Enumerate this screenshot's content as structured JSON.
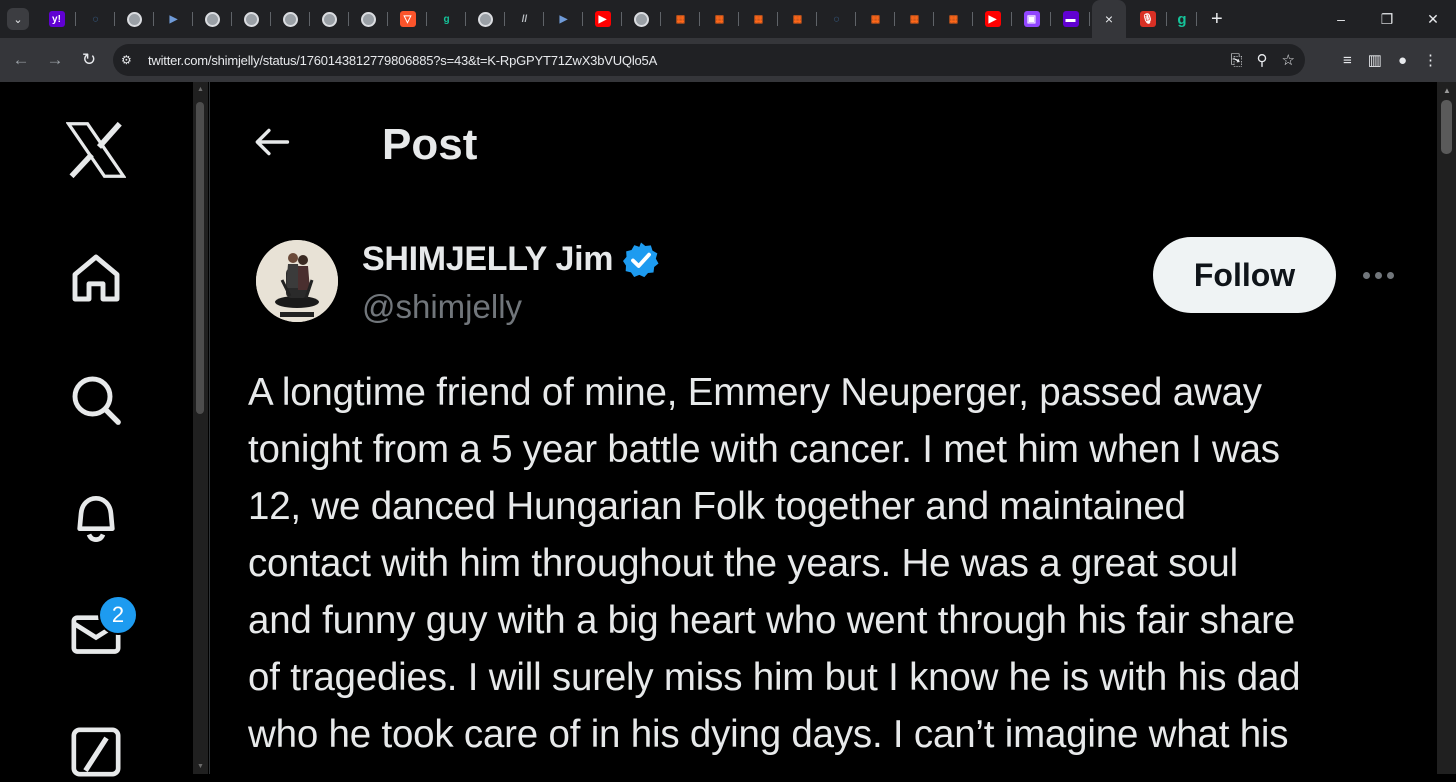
{
  "browser": {
    "url": "twitter.com/shimjelly/status/1760143812779806885?s=43&t=K-RpGPYT71ZwX3bVUQlo5A",
    "tab_icons": [
      "yahoo",
      "shield",
      "globe",
      "pocket",
      "globe",
      "globe",
      "globe",
      "globe",
      "globe",
      "brave",
      "grammarly",
      "globe",
      "ai",
      "pocket",
      "youtube",
      "globe",
      "substack",
      "substack",
      "substack",
      "substack",
      "shield",
      "substack",
      "substack",
      "substack",
      "youtube",
      "twitch",
      "yahoo-mail"
    ],
    "active_tab_close": "×",
    "extra_tab_icons": [
      "podcast",
      "grammarly"
    ],
    "new_tab": "+",
    "window_controls": [
      "–",
      "❐",
      "✕"
    ]
  },
  "sidebar": {
    "items": [
      "x-logo",
      "home",
      "search",
      "notifications",
      "messages",
      "grok"
    ],
    "messages_badge": "2"
  },
  "header": {
    "title": "Post"
  },
  "post": {
    "author_name": "SHIMJELLY Jim",
    "author_handle": "@shimjelly",
    "follow_label": "Follow",
    "text": "A longtime friend of mine, Emmery Neuperger, passed away\ntonight from a 5 year battle with cancer. I met him when I was\n12, we danced Hungarian Folk together and maintained\ncontact with him throughout the years. He was a great soul\nand funny guy with a big heart who went through his fair share\nof tragedies. I will surely miss him but I know he is with his dad\nwho he took care of in his dying days. I can’t imagine what his"
  },
  "colors": {
    "accent": "#1d9bf0",
    "background": "#000000",
    "text": "#e7e9ea",
    "muted": "#71767b"
  }
}
